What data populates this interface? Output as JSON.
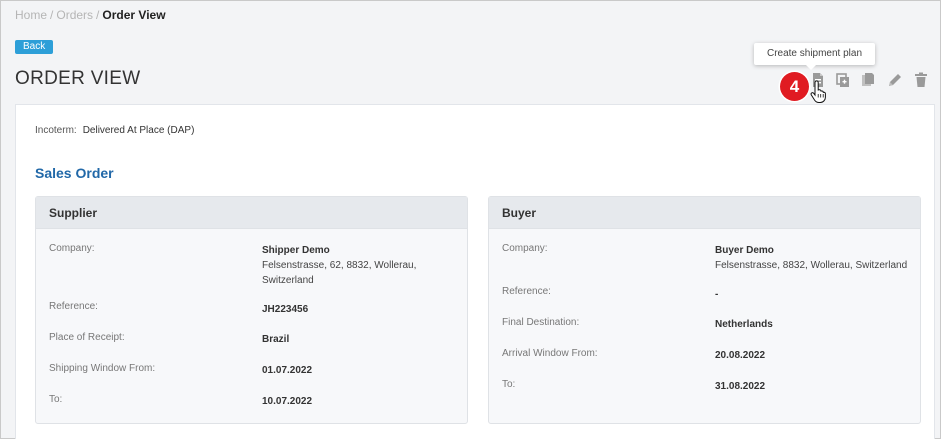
{
  "breadcrumb": {
    "home": "Home",
    "orders": "Orders",
    "current": "Order View"
  },
  "back_label": "Back",
  "page_title": "ORDER VIEW",
  "tooltip": "Create shipment plan",
  "step_badge": "4",
  "toolbar": {
    "icons": [
      "create-shipment-plan-icon",
      "copy-icon",
      "duplicate-icon",
      "edit-icon",
      "delete-icon"
    ],
    "icon_color": "#9a9a9a"
  },
  "incoterm": {
    "label": "Incoterm:",
    "value": "Delivered At Place (DAP)"
  },
  "section_title": "Sales Order",
  "supplier": {
    "title": "Supplier",
    "company_label": "Company:",
    "company_name": "Shipper Demo",
    "company_address_1": "Felsenstrasse, 62, 8832, Wollerau,",
    "company_address_2": "Switzerland",
    "reference_label": "Reference:",
    "reference": "JH223456",
    "place_label": "Place of Receipt:",
    "place": "Brazil",
    "window_from_label": "Shipping Window From:",
    "window_from": "01.07.2022",
    "to_label": "To:",
    "to": "10.07.2022"
  },
  "buyer": {
    "title": "Buyer",
    "company_label": "Company:",
    "company_name": "Buyer Demo",
    "company_address_1": "Felsenstrasse, 8832, Wollerau, Switzerland",
    "reference_label": "Reference:",
    "reference": "-",
    "destination_label": "Final Destination:",
    "destination": "Netherlands",
    "arrival_from_label": "Arrival Window From:",
    "arrival_from": "20.08.2022",
    "to_label": "To:",
    "to": "31.08.2022"
  },
  "colors": {
    "accent": "#2168a8",
    "back_button": "#2d9fd8",
    "badge": "#e01b22"
  }
}
